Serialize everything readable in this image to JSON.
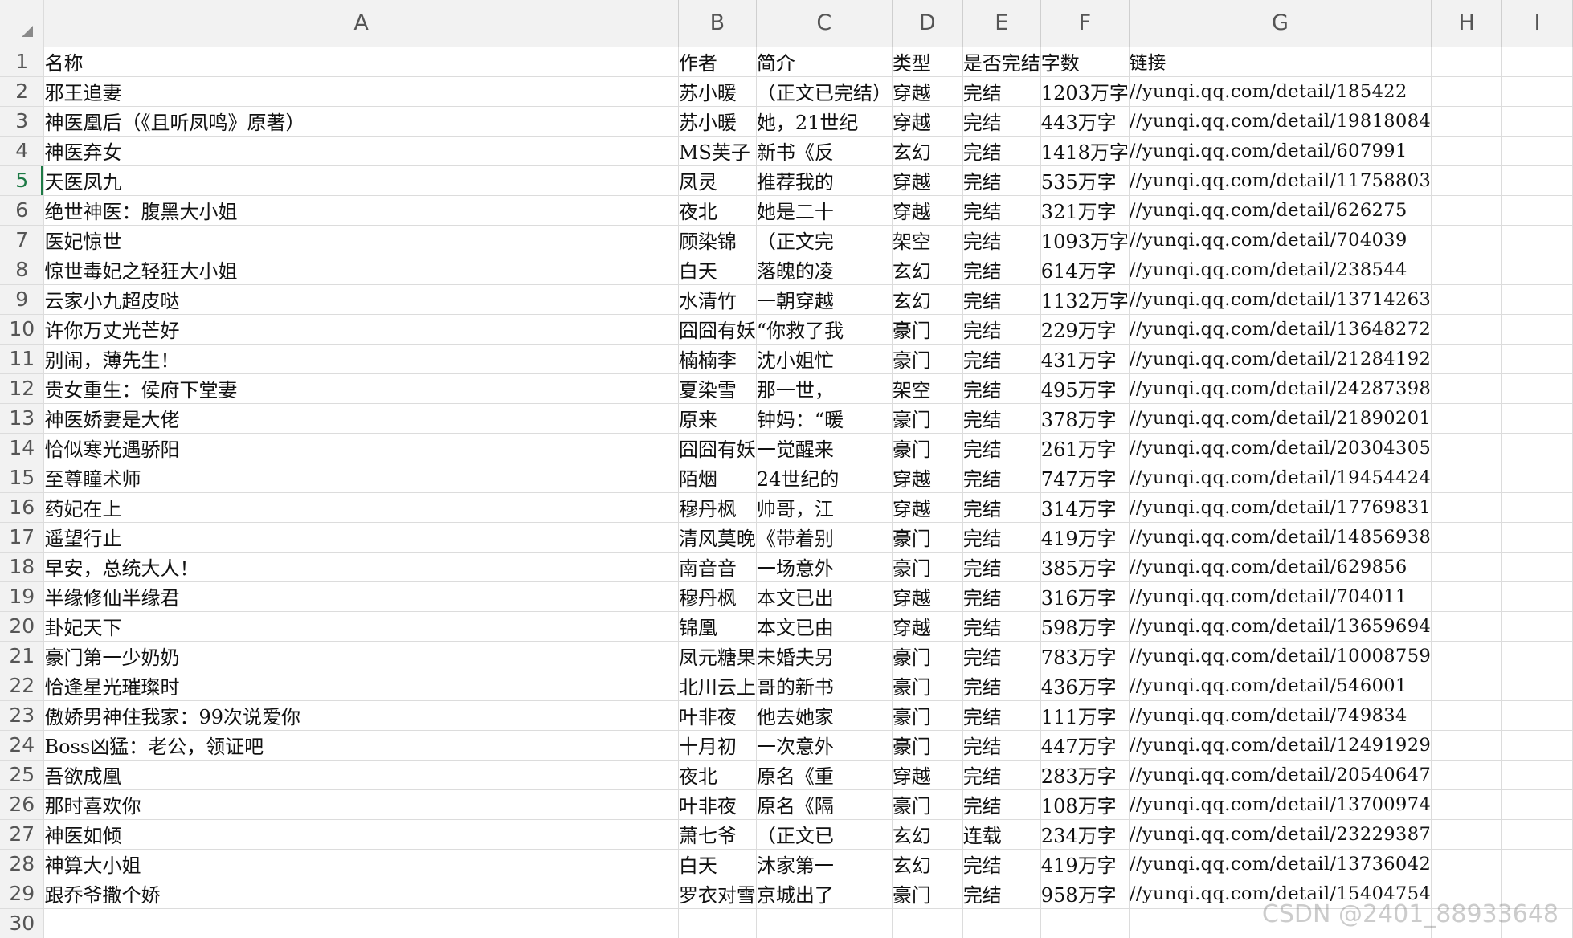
{
  "columns": [
    "A",
    "B",
    "C",
    "D",
    "E",
    "F",
    "G",
    "H",
    "I"
  ],
  "rows": [
    {
      "num": "1",
      "cells": [
        "名称",
        "作者",
        "简介",
        "类型",
        "是否完结",
        "字数",
        "链接",
        "",
        ""
      ]
    },
    {
      "num": "2",
      "cells": [
        "邪王追妻",
        "苏小暖",
        "（正文已完结）",
        "穿越",
        "完结",
        "1203万字",
        "//yunqi.qq.com/detail/185422",
        "",
        ""
      ]
    },
    {
      "num": "3",
      "cells": [
        "神医凰后（《且听凤鸣》原著）",
        "苏小暖",
        "她，21世纪",
        "穿越",
        "完结",
        "443万字",
        "//yunqi.qq.com/detail/19818084",
        "",
        ""
      ]
    },
    {
      "num": "4",
      "cells": [
        "神医弃女",
        "MS芙子",
        "新书《反",
        "玄幻",
        "完结",
        "1418万字",
        "//yunqi.qq.com/detail/607991",
        "",
        ""
      ]
    },
    {
      "num": "5",
      "cells": [
        "天医凤九",
        "凤灵",
        "推荐我的",
        "穿越",
        "完结",
        "535万字",
        "//yunqi.qq.com/detail/11758803",
        "",
        ""
      ]
    },
    {
      "num": "6",
      "cells": [
        "绝世神医：腹黑大小姐",
        "夜北",
        "她是二十",
        "穿越",
        "完结",
        "321万字",
        "//yunqi.qq.com/detail/626275",
        "",
        ""
      ]
    },
    {
      "num": "7",
      "cells": [
        "医妃惊世",
        "顾染锦",
        "（正文完",
        "架空",
        "完结",
        "1093万字",
        "//yunqi.qq.com/detail/704039",
        "",
        ""
      ]
    },
    {
      "num": "8",
      "cells": [
        "惊世毒妃之轻狂大小姐",
        "白天",
        "落魄的凌",
        "玄幻",
        "完结",
        "614万字",
        "//yunqi.qq.com/detail/238544",
        "",
        ""
      ]
    },
    {
      "num": "9",
      "cells": [
        "云家小九超皮哒",
        "水清竹",
        "一朝穿越",
        "玄幻",
        "完结",
        "1132万字",
        "//yunqi.qq.com/detail/13714263",
        "",
        ""
      ]
    },
    {
      "num": "10",
      "cells": [
        "许你万丈光芒好",
        "囧囧有妖",
        "“你救了我",
        "豪门",
        "完结",
        "229万字",
        "//yunqi.qq.com/detail/13648272",
        "",
        ""
      ]
    },
    {
      "num": "11",
      "cells": [
        "别闹，薄先生！",
        "楠楠李",
        "沈小姐忙",
        "豪门",
        "完结",
        "431万字",
        "//yunqi.qq.com/detail/21284192",
        "",
        ""
      ]
    },
    {
      "num": "12",
      "cells": [
        "贵女重生：侯府下堂妻",
        "夏染雪",
        "那一世，",
        "架空",
        "完结",
        "495万字",
        "//yunqi.qq.com/detail/24287398",
        "",
        ""
      ]
    },
    {
      "num": "13",
      "cells": [
        "神医娇妻是大佬",
        "原来",
        "钟妈：“暖",
        "豪门",
        "完结",
        "378万字",
        "//yunqi.qq.com/detail/21890201",
        "",
        ""
      ]
    },
    {
      "num": "14",
      "cells": [
        "恰似寒光遇骄阳",
        "囧囧有妖",
        "一觉醒来",
        "豪门",
        "完结",
        "261万字",
        "//yunqi.qq.com/detail/20304305",
        "",
        ""
      ]
    },
    {
      "num": "15",
      "cells": [
        "至尊瞳术师",
        "陌烟",
        "24世纪的",
        "穿越",
        "完结",
        "747万字",
        "//yunqi.qq.com/detail/19454424",
        "",
        ""
      ]
    },
    {
      "num": "16",
      "cells": [
        "药妃在上",
        "穆丹枫",
        "帅哥，江",
        "穿越",
        "完结",
        "314万字",
        "//yunqi.qq.com/detail/17769831",
        "",
        ""
      ]
    },
    {
      "num": "17",
      "cells": [
        "遥望行止",
        "清风莫晚",
        "《带着别",
        "豪门",
        "完结",
        "419万字",
        "//yunqi.qq.com/detail/14856938",
        "",
        ""
      ]
    },
    {
      "num": "18",
      "cells": [
        "早安，总统大人！",
        "南音音",
        "一场意外",
        "豪门",
        "完结",
        "385万字",
        "//yunqi.qq.com/detail/629856",
        "",
        ""
      ]
    },
    {
      "num": "19",
      "cells": [
        "半缘修仙半缘君",
        "穆丹枫",
        "本文已出",
        "穿越",
        "完结",
        "316万字",
        "//yunqi.qq.com/detail/704011",
        "",
        ""
      ]
    },
    {
      "num": "20",
      "cells": [
        "卦妃天下",
        "锦凰",
        "本文已由",
        "穿越",
        "完结",
        "598万字",
        "//yunqi.qq.com/detail/13659694",
        "",
        ""
      ]
    },
    {
      "num": "21",
      "cells": [
        "豪门第一少奶奶",
        "凤元糖果",
        "未婚夫另",
        "豪门",
        "完结",
        "783万字",
        "//yunqi.qq.com/detail/10008759",
        "",
        ""
      ]
    },
    {
      "num": "22",
      "cells": [
        "恰逢星光璀璨时",
        "北川云上",
        "哥的新书",
        "豪门",
        "完结",
        "436万字",
        "//yunqi.qq.com/detail/546001",
        "",
        ""
      ]
    },
    {
      "num": "23",
      "cells": [
        "傲娇男神住我家：99次说爱你",
        "叶非夜",
        "他去她家",
        "豪门",
        "完结",
        "111万字",
        "//yunqi.qq.com/detail/749834",
        "",
        ""
      ]
    },
    {
      "num": "24",
      "cells": [
        "Boss凶猛：老公，领证吧",
        "十月初",
        "一次意外",
        "豪门",
        "完结",
        "447万字",
        "//yunqi.qq.com/detail/12491929",
        "",
        ""
      ]
    },
    {
      "num": "25",
      "cells": [
        "吾欲成凰",
        "夜北",
        "原名《重",
        "穿越",
        "完结",
        "283万字",
        "//yunqi.qq.com/detail/20540647",
        "",
        ""
      ]
    },
    {
      "num": "26",
      "cells": [
        "那时喜欢你",
        "叶非夜",
        "原名《隔",
        "豪门",
        "完结",
        "108万字",
        "//yunqi.qq.com/detail/13700974",
        "",
        ""
      ]
    },
    {
      "num": "27",
      "cells": [
        "神医如倾",
        "萧七爷",
        "（正文已",
        "玄幻",
        "连载",
        "234万字",
        "//yunqi.qq.com/detail/23229387",
        "",
        ""
      ]
    },
    {
      "num": "28",
      "cells": [
        "神算大小姐",
        "白天",
        "沐家第一",
        "玄幻",
        "完结",
        "419万字",
        "//yunqi.qq.com/detail/13736042",
        "",
        ""
      ]
    },
    {
      "num": "29",
      "cells": [
        "跟乔爷撒个娇",
        "罗衣对雪",
        "京城出了",
        "豪门",
        "完结",
        "958万字",
        "//yunqi.qq.com/detail/15404754",
        "",
        ""
      ]
    },
    {
      "num": "30",
      "cells": [
        "",
        "",
        "",
        "",
        "",
        "",
        "",
        "",
        ""
      ]
    }
  ],
  "active_row": "5",
  "watermark": "CSDN @2401_88933648",
  "colors": {
    "header_bg": "#f2f2f2",
    "active_green": "#1d7a45",
    "grid": "#dcdcdc"
  }
}
